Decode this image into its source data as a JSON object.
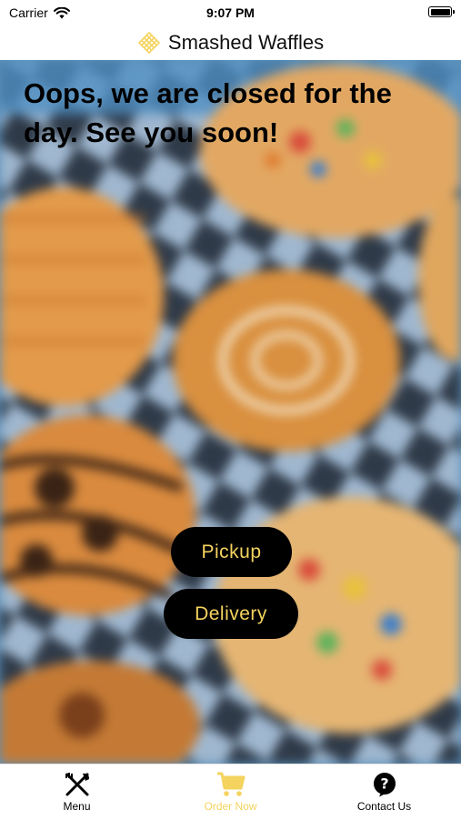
{
  "status_bar": {
    "carrier": "Carrier",
    "time": "9:07 PM",
    "icons": [
      "wifi-icon",
      "battery-icon"
    ]
  },
  "header": {
    "logo_icon": "waffle-logo-icon",
    "title": "Smashed Waffles"
  },
  "main": {
    "closed_message": "Oops, we are closed for the day. See you soon!",
    "buttons": {
      "pickup_label": "Pickup",
      "delivery_label": "Delivery"
    }
  },
  "tab_bar": {
    "items": [
      {
        "label": "Menu",
        "icon": "fork-knife-icon",
        "active": false
      },
      {
        "label": "Order Now",
        "icon": "cart-icon",
        "active": true
      },
      {
        "label": "Contact Us",
        "icon": "question-circle-icon",
        "active": false
      }
    ]
  },
  "colors": {
    "accent": "#f4d35e",
    "button_bg": "#000000",
    "text": "#000000"
  }
}
